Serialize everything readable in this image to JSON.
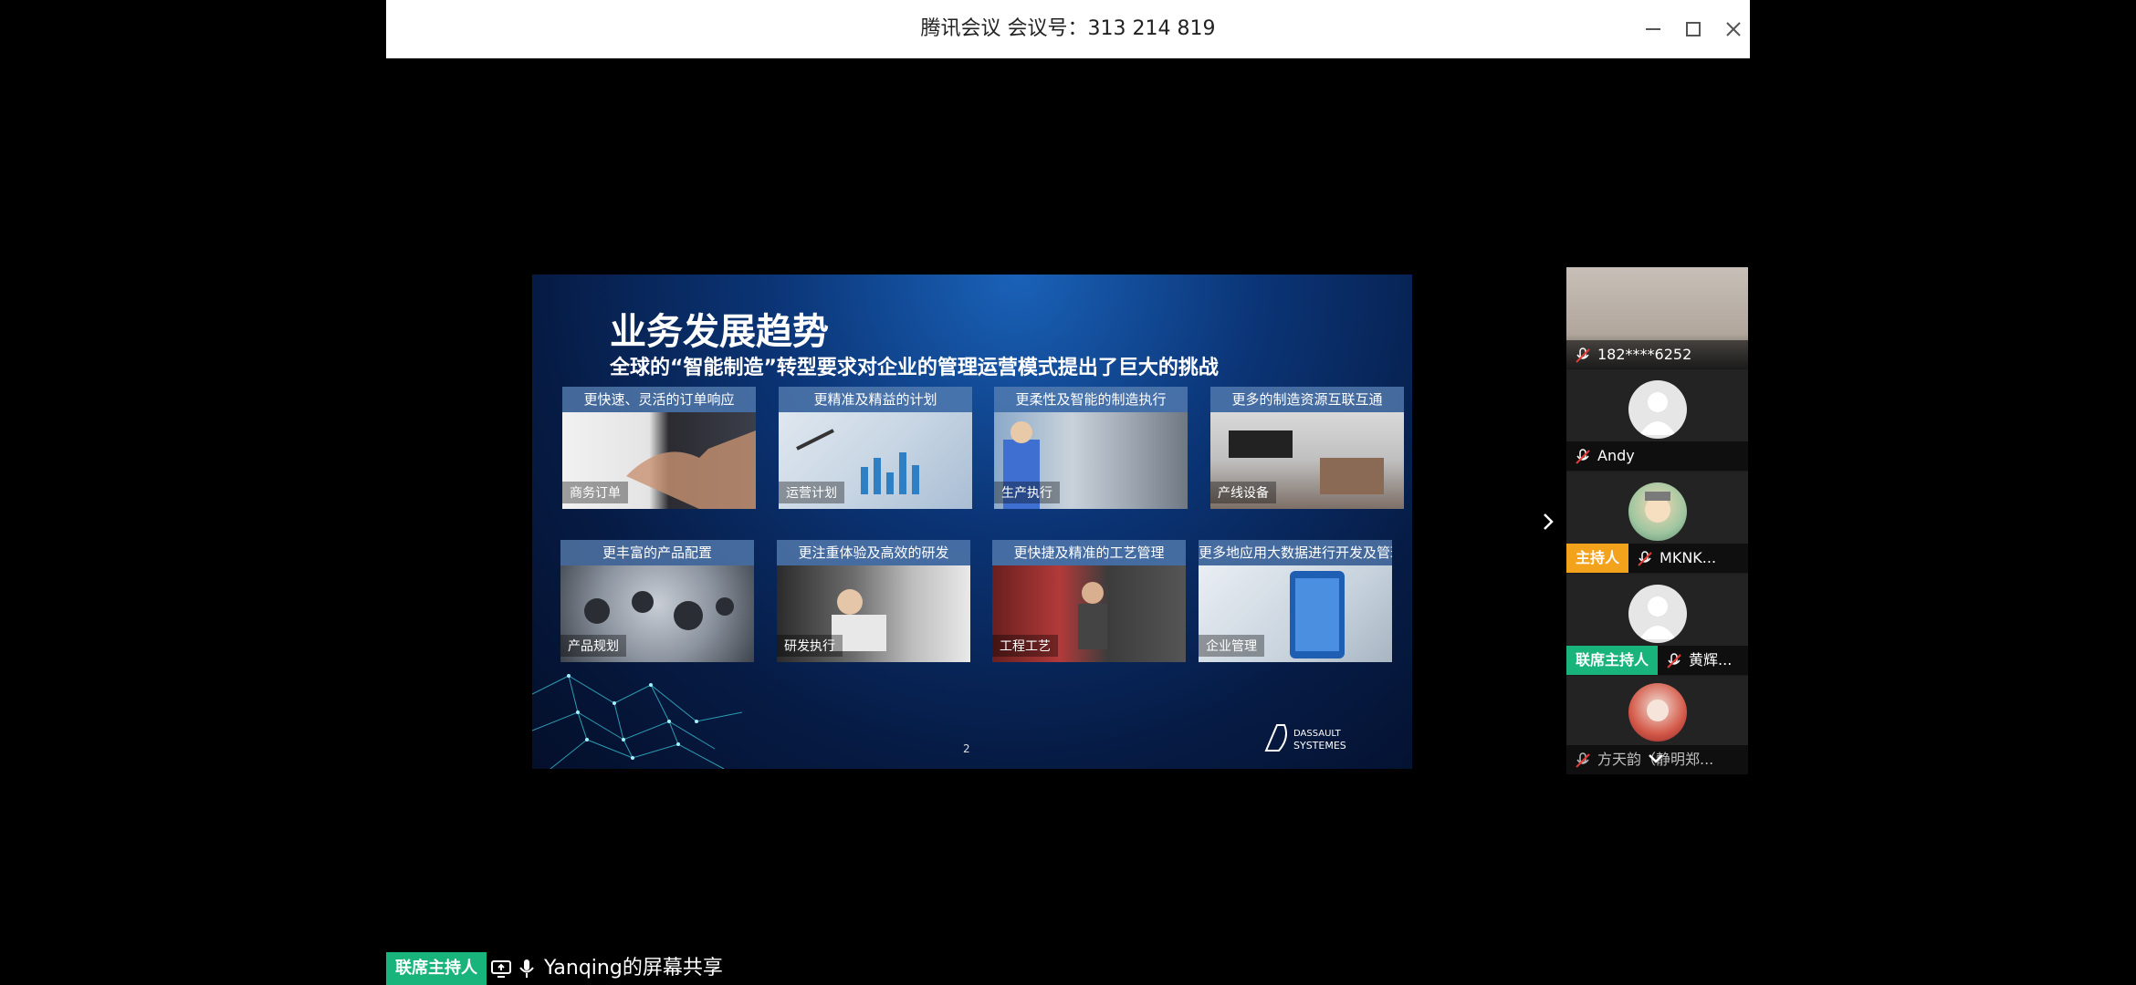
{
  "window": {
    "title": "腾讯会议 会议号：313 214 819",
    "controls": {
      "minimize": "minimize-icon",
      "maximize": "maximize-icon",
      "close": "close-icon"
    }
  },
  "slide": {
    "title": "业务发展趋势",
    "subtitle": "全球的“智能制造”转型要求对企业的管理运营模式提出了巨大的挑战",
    "page_number": "2",
    "logo_text": [
      "DASSAULT",
      "SYSTEMES"
    ],
    "cards": [
      {
        "header": "更快速、灵活的订单响应",
        "label": "商务订单"
      },
      {
        "header": "更精准及精益的计划",
        "label": "运营计划"
      },
      {
        "header": "更柔性及智能的制造执行",
        "label": "生产执行"
      },
      {
        "header": "更多的制造资源互联互通",
        "label": "产线设备"
      },
      {
        "header": "更丰富的产品配置",
        "label": "产品规划"
      },
      {
        "header": "更注重体验及高效的研发",
        "label": "研发执行"
      },
      {
        "header": "更快捷及精准的工艺管理",
        "label": "工程工艺"
      },
      {
        "header": "更多地应用大数据进行开发及管理",
        "label": "企业管理"
      }
    ]
  },
  "participants": [
    {
      "name": "182****6252",
      "badge": ""
    },
    {
      "name": "Andy",
      "badge": ""
    },
    {
      "name": "MKNK...",
      "badge": "主持人"
    },
    {
      "name": "黄辉...",
      "badge": "联席主持人"
    },
    {
      "name": "方天韵（静明郑...",
      "badge": ""
    }
  ],
  "bottom_bar": {
    "badge": "联席主持人",
    "share_text": "Yanqing的屏幕共享"
  },
  "colors": {
    "host": "#f3a21c",
    "cohost": "#19b47c",
    "slide_bg": "#0b3577"
  }
}
